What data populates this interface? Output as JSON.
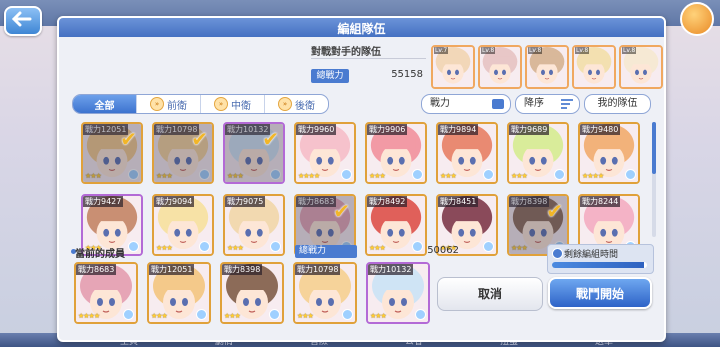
{
  "dialog": {
    "title": "編組隊伍"
  },
  "opponent": {
    "label": "對戰對手的隊伍",
    "power_label": "總戰力",
    "power_value": "55158",
    "portraits": [
      {
        "level": "Lv.7",
        "name": "opponent-1",
        "color": "#f2d7b8"
      },
      {
        "level": "Lv.8",
        "name": "opponent-2",
        "color": "#e8c7c7"
      },
      {
        "level": "Lv.8",
        "name": "opponent-3",
        "color": "#d9b89a"
      },
      {
        "level": "Lv.8",
        "name": "opponent-4",
        "color": "#f3e0b0"
      },
      {
        "level": "Lv.8",
        "name": "opponent-5",
        "color": "#f6e9d4"
      }
    ]
  },
  "filter_tabs": [
    {
      "label": "全部",
      "active": true
    },
    {
      "label": "前衛",
      "active": false
    },
    {
      "label": "中衛",
      "active": false
    },
    {
      "label": "後衛",
      "active": false
    }
  ],
  "sort": {
    "power_label": "戰力",
    "order_label": "降序",
    "my_team_label": "我的隊伍"
  },
  "roster": [
    {
      "power": "戰力12051",
      "stars": "★★★",
      "selected": true,
      "frame": "gold",
      "color": "#f4c98a"
    },
    {
      "power": "戰力10798",
      "stars": "★★★",
      "selected": true,
      "frame": "gold",
      "color": "#f6d39a"
    },
    {
      "power": "戰力10132",
      "stars": "★★★",
      "selected": true,
      "frame": "purple",
      "color": "#cfe4f5"
    },
    {
      "power": "戰力9960",
      "stars": "★★★★",
      "selected": false,
      "frame": "gold",
      "color": "#f6c2cc"
    },
    {
      "power": "戰力9906",
      "stars": "★★★",
      "selected": false,
      "frame": "gold",
      "color": "#f29aa5"
    },
    {
      "power": "戰力9894",
      "stars": "★★★",
      "selected": false,
      "frame": "gold",
      "color": "#e98a72"
    },
    {
      "power": "戰力9689",
      "stars": "★★★",
      "selected": false,
      "frame": "gold",
      "color": "#d9ec9a"
    },
    {
      "power": "戰力9480",
      "stars": "★★★★",
      "selected": false,
      "frame": "gold",
      "color": "#f2b27a"
    },
    {
      "power": "戰力9427",
      "stars": "★★★",
      "selected": false,
      "frame": "purple",
      "color": "#c98f73"
    },
    {
      "power": "戰力9094",
      "stars": "★★★",
      "selected": false,
      "frame": "gold",
      "color": "#f7e2a6"
    },
    {
      "power": "戰力9075",
      "stars": "★★★",
      "selected": false,
      "frame": "gold",
      "color": "#f2d9b0"
    },
    {
      "power": "戰力8683",
      "stars": "★★★★",
      "selected": true,
      "frame": "gold",
      "color": "#e6a5b6"
    },
    {
      "power": "戰力8492",
      "stars": "★★★",
      "selected": false,
      "frame": "gold",
      "color": "#e0605a"
    },
    {
      "power": "戰力8451",
      "stars": "★★★",
      "selected": false,
      "frame": "gold",
      "color": "#8a4a5a"
    },
    {
      "power": "戰力8398",
      "stars": "★★★",
      "selected": true,
      "frame": "gold",
      "color": "#8c6b58"
    },
    {
      "power": "戰力8244",
      "stars": "★★★",
      "selected": false,
      "frame": "gold",
      "color": "#f4b3c6"
    }
  ],
  "members": {
    "label": "當前的成員",
    "total_label": "總戰力",
    "total_value": "50062",
    "remain_label": "剩餘編組時間",
    "remain_fraction": 0.97,
    "team": [
      {
        "power": "戰力8683",
        "stars": "★★★★",
        "frame": "gold",
        "color": "#e6a5b6"
      },
      {
        "power": "戰力12051",
        "stars": "★★★",
        "frame": "gold",
        "color": "#f4c98a"
      },
      {
        "power": "戰力8398",
        "stars": "★★★",
        "frame": "gold",
        "color": "#8c6b58"
      },
      {
        "power": "戰力10798",
        "stars": "★★★",
        "frame": "gold",
        "color": "#f6d39a"
      },
      {
        "power": "戰力10132",
        "stars": "★★★",
        "frame": "purple",
        "color": "#cfe4f5"
      }
    ]
  },
  "buttons": {
    "cancel": "取消",
    "battle": "戰鬥開始"
  },
  "background": {
    "nav_items": [
      "主頁",
      "劇情",
      "冒險",
      "公會",
      "扭蛋",
      "選單"
    ]
  }
}
